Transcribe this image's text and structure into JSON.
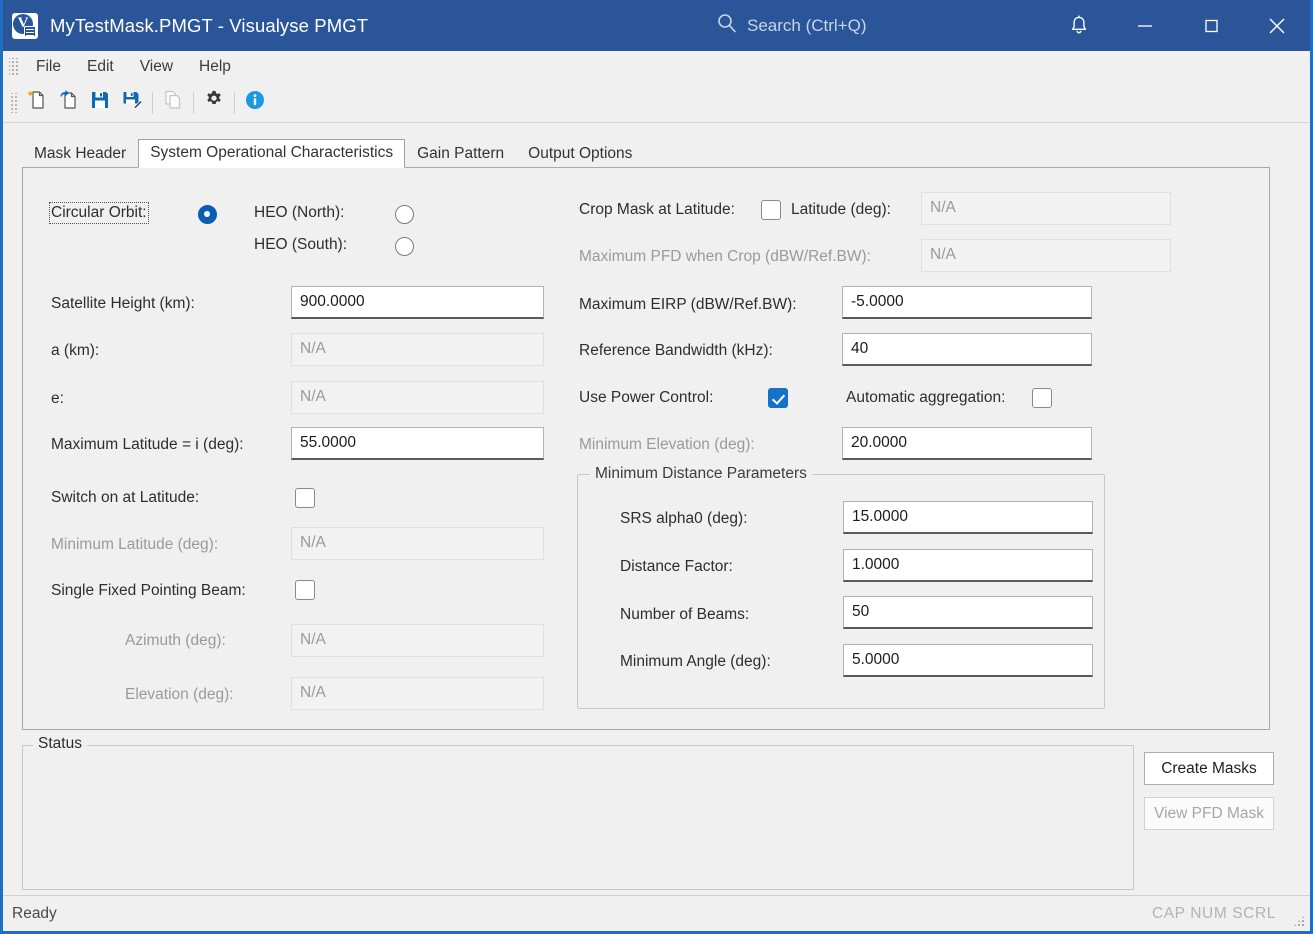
{
  "titlebar": {
    "app_icon": "visualyse-logo-icon",
    "title": "MyTestMask.PMGT - Visualyse PMGT",
    "search_placeholder": "Search (Ctrl+Q)",
    "search_icon": "search-icon",
    "bell_icon": "notification-bell-icon",
    "minimize_icon": "minimize-icon",
    "maximize_icon": "maximize-icon",
    "close_icon": "close-icon",
    "bg_color": "#2a5699"
  },
  "menubar": {
    "items": [
      {
        "label": "File"
      },
      {
        "label": "Edit"
      },
      {
        "label": "View"
      },
      {
        "label": "Help"
      }
    ]
  },
  "toolbar": {
    "buttons": [
      {
        "icon": "new-document-icon",
        "enabled": true
      },
      {
        "icon": "open-document-icon",
        "enabled": true
      },
      {
        "icon": "save-icon",
        "enabled": true
      },
      {
        "icon": "save-as-icon",
        "enabled": true
      },
      {
        "icon": "copy-icon",
        "enabled": false
      },
      {
        "icon": "gear-icon",
        "enabled": true
      },
      {
        "icon": "info-icon",
        "enabled": true
      }
    ]
  },
  "tabs": [
    {
      "label": "Mask Header",
      "selected": false
    },
    {
      "label": "System Operational Characteristics",
      "selected": true
    },
    {
      "label": "Gain Pattern",
      "selected": false
    },
    {
      "label": "Output Options",
      "selected": false
    }
  ],
  "form": {
    "left_column": {
      "orbit_type_label": "Circular Orbit:",
      "orbit_type_selected": true,
      "heo_north_label": "HEO (North):",
      "heo_north_selected": false,
      "heo_south_label": "HEO (South):",
      "heo_south_selected": false,
      "satellite_height_label": "Satellite Height (km):",
      "satellite_height_value": "900.0000",
      "a_label": "a (km):",
      "a_value": "N/A",
      "e_label": "e:",
      "e_value": "N/A",
      "max_latitude_label": "Maximum Latitude = i (deg):",
      "max_latitude_value": "55.0000",
      "switch_on_latitude_label": "Switch on at Latitude:",
      "switch_on_latitude_checked": false,
      "minimum_latitude_label": "Minimum Latitude (deg):",
      "minimum_latitude_value": "N/A",
      "single_fixed_beam_label": "Single Fixed Pointing Beam:",
      "single_fixed_beam_checked": false,
      "azimuth_label": "Azimuth (deg):",
      "azimuth_value": "N/A",
      "elevation_label": "Elevation (deg):",
      "elevation_value": "N/A"
    },
    "right_column": {
      "crop_mask_label": "Crop Mask at Latitude:",
      "crop_mask_checked": false,
      "crop_latitude_label": "Latitude (deg):",
      "crop_latitude_value": "N/A",
      "max_pfd_label": "Maximum PFD when Crop (dBW/Ref.BW):",
      "max_pfd_value": "N/A",
      "max_eirp_label": "Maximum EIRP (dBW/Ref.BW):",
      "max_eirp_value": "-5.0000",
      "reference_bandwidth_label": "Reference Bandwidth (kHz):",
      "reference_bandwidth_value": "40",
      "use_power_control_label": "Use Power Control:",
      "use_power_control_checked": true,
      "automatic_aggregation_label": "Automatic aggregation:",
      "automatic_aggregation_checked": false,
      "minimum_elevation_label": "Minimum Elevation (deg):",
      "minimum_elevation_value": "20.0000"
    },
    "min_distance_group": {
      "title": "Minimum Distance Parameters",
      "srs_alpha0_label": "SRS alpha0 (deg):",
      "srs_alpha0_value": "15.0000",
      "distance_factor_label": "Distance Factor:",
      "distance_factor_value": "1.0000",
      "number_of_beams_label": "Number of Beams:",
      "number_of_beams_value": "50",
      "minimum_angle_label": "Minimum Angle (deg):",
      "minimum_angle_value": "5.0000"
    }
  },
  "status_section": {
    "title": "Status",
    "content": "",
    "create_masks_label": "Create Masks",
    "view_pfd_mask_label": "View PFD Mask",
    "view_pfd_mask_enabled": false
  },
  "statusbar": {
    "ready_text": "Ready",
    "indicators": "CAP NUM SCRL",
    "resize_grip_icon": "resize-grip-icon"
  },
  "colors": {
    "titlebar": "#2a5699",
    "window_border": "#1d6fc4",
    "accent_checkbox": "#1572c9",
    "accent_radio": "#0b5cb5",
    "panel_bg": "#f0f0f0"
  }
}
